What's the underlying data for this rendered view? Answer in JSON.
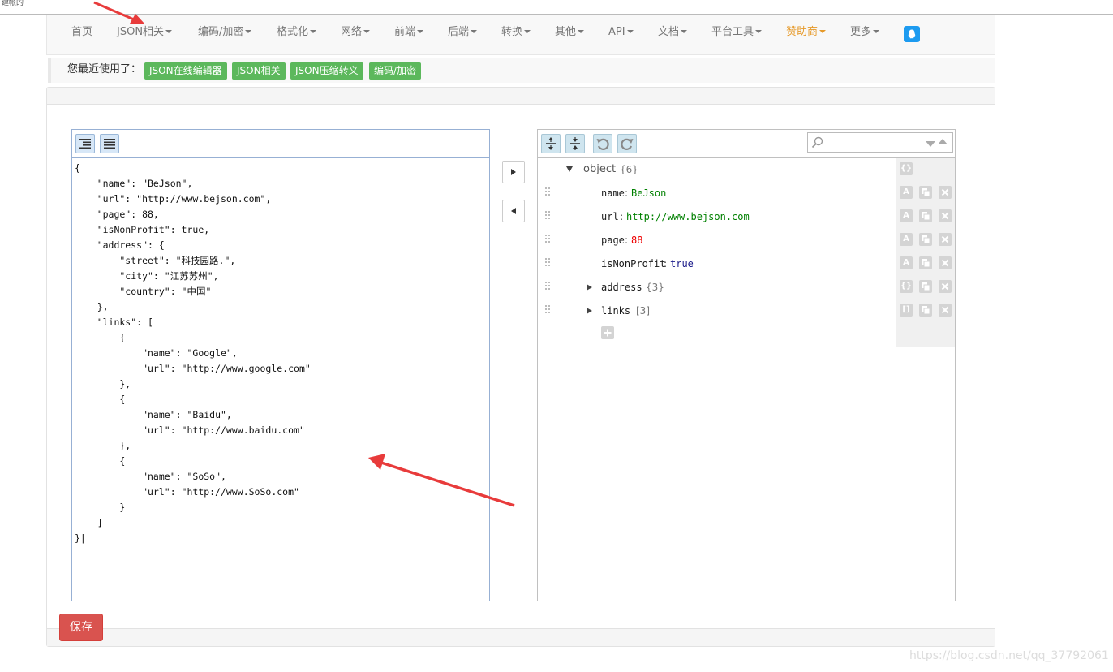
{
  "topline": {
    "text": "建帐的"
  },
  "nav": {
    "items": [
      {
        "label": "首页",
        "caret": false,
        "sponsor": false
      },
      {
        "label": "JSON相关",
        "caret": true,
        "sponsor": false
      },
      {
        "label": "编码/加密",
        "caret": true,
        "sponsor": false
      },
      {
        "label": "格式化",
        "caret": true,
        "sponsor": false
      },
      {
        "label": "网络",
        "caret": true,
        "sponsor": false
      },
      {
        "label": "前端",
        "caret": true,
        "sponsor": false
      },
      {
        "label": "后端",
        "caret": true,
        "sponsor": false
      },
      {
        "label": "转换",
        "caret": true,
        "sponsor": false
      },
      {
        "label": "其他",
        "caret": true,
        "sponsor": false
      },
      {
        "label": "API",
        "caret": true,
        "sponsor": false
      },
      {
        "label": "文档",
        "caret": true,
        "sponsor": false
      },
      {
        "label": "平台工具",
        "caret": true,
        "sponsor": false
      },
      {
        "label": "赞助商",
        "caret": true,
        "sponsor": true
      },
      {
        "label": "更多",
        "caret": true,
        "sponsor": false
      }
    ],
    "qq_icon": "qq-icon"
  },
  "recent": {
    "label": "您最近使用了：",
    "tags": [
      "JSON在线编辑器",
      "JSON相关",
      "JSON压缩转义",
      "编码/加密"
    ]
  },
  "left_editor": {
    "code": "{\n    \"name\": \"BeJson\",\n    \"url\": \"http://www.bejson.com\",\n    \"page\": 88,\n    \"isNonProfit\": true,\n    \"address\": {\n        \"street\": \"科技园路.\",\n        \"city\": \"江苏苏州\",\n        \"country\": \"中国\"\n    },\n    \"links\": [\n        {\n            \"name\": \"Google\",\n            \"url\": \"http://www.google.com\"\n        },\n        {\n            \"name\": \"Baidu\",\n            \"url\": \"http://www.baidu.com\"\n        },\n        {\n            \"name\": \"SoSo\",\n            \"url\": \"http://www.SoSo.com\"\n        }\n    ]\n}|"
  },
  "tree": {
    "root_label": "object",
    "root_count": "{6}",
    "rows": [
      {
        "key": "name",
        "value": "BeJson",
        "kind": "string",
        "action": "A"
      },
      {
        "key": "url",
        "value": "http://www.bejson.com",
        "kind": "string",
        "action": "A"
      },
      {
        "key": "page",
        "value": "88",
        "kind": "number",
        "action": "A"
      },
      {
        "key": "isNonProfit",
        "value": "true",
        "kind": "boolean",
        "action": "A"
      },
      {
        "key": "address",
        "value": "{3}",
        "kind": "object",
        "action": "{}"
      },
      {
        "key": "links",
        "value": "[3]",
        "kind": "array",
        "action": "[]"
      }
    ],
    "separator": ":",
    "root_action": "{}",
    "dup_icon": "duplicate-icon",
    "remove_icon": "remove-icon"
  },
  "buttons": {
    "save": "保存"
  },
  "watermark": "https://blog.csdn.net/qq_37792061",
  "colors": {
    "sponsor": "#e69a2a",
    "tag": "#5cb85c",
    "save": "#d9534f",
    "annotation_arrow": "#e83b3b"
  }
}
